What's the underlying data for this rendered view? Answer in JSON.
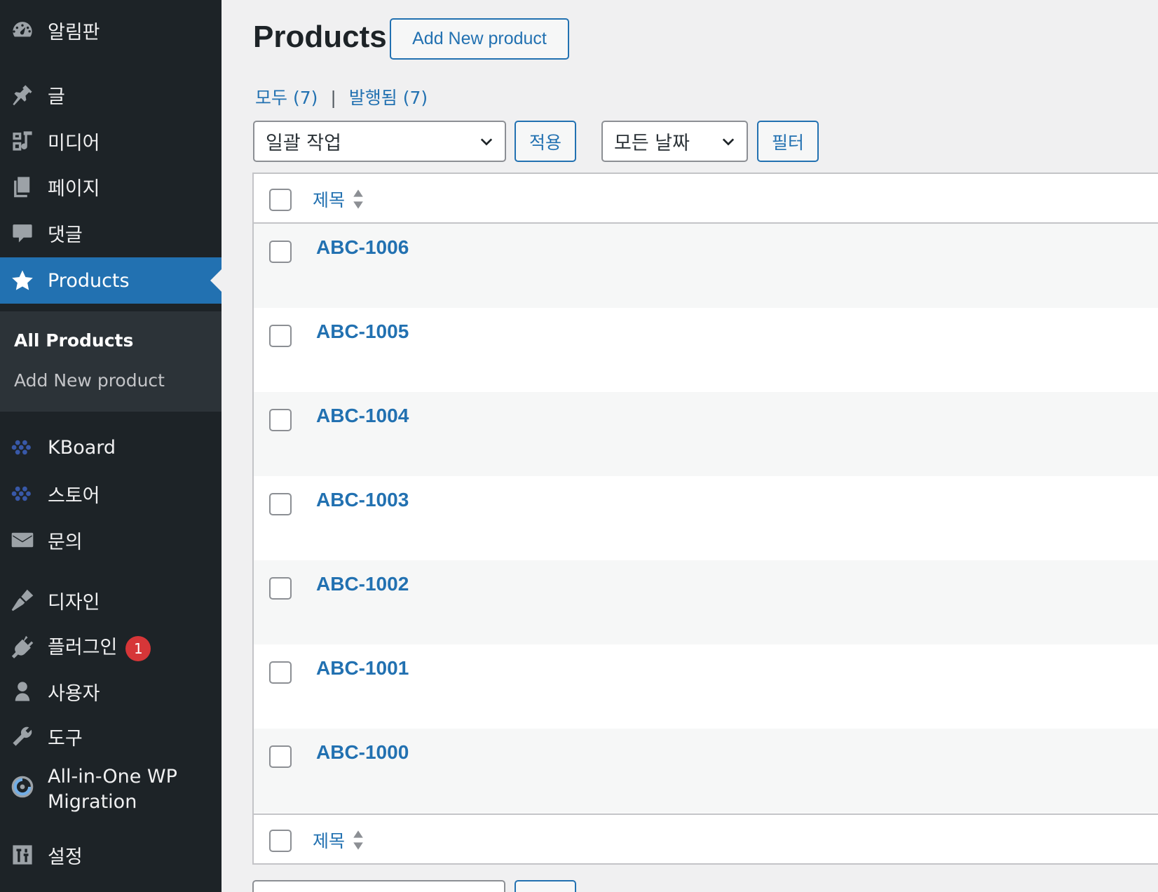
{
  "sidebar": {
    "items": [
      {
        "label": "알림판",
        "icon": "dashboard-icon"
      },
      {
        "label": "글",
        "icon": "pin-icon"
      },
      {
        "label": "미디어",
        "icon": "media-icon"
      },
      {
        "label": "페이지",
        "icon": "page-icon"
      },
      {
        "label": "댓글",
        "icon": "comment-icon"
      },
      {
        "label": "Products",
        "icon": "star-icon",
        "active": true
      },
      {
        "label": "KBoard",
        "icon": "kboard-icon"
      },
      {
        "label": "스토어",
        "icon": "store-icon"
      },
      {
        "label": "문의",
        "icon": "mail-icon"
      },
      {
        "label": "디자인",
        "icon": "brush-icon"
      },
      {
        "label": "플러그인",
        "icon": "plugin-icon",
        "badge": "1"
      },
      {
        "label": "사용자",
        "icon": "user-icon"
      },
      {
        "label": "도구",
        "icon": "wrench-icon"
      },
      {
        "label": "All-in-One WP",
        "label2": "Migration",
        "icon": "migration-icon"
      },
      {
        "label": "설정",
        "icon": "settings-icon"
      }
    ],
    "submenu": {
      "current": "All Products",
      "add_new": "Add New product"
    }
  },
  "main": {
    "title": "Products",
    "add_new_label": "Add New product",
    "views": {
      "all_label": "모두",
      "all_count": "(7)",
      "separator": "|",
      "published_label": "발행됨",
      "published_count": "(7)"
    },
    "bulk_action": {
      "selected": "일괄 작업",
      "apply_label": "적용"
    },
    "date_filter": {
      "selected": "모든 날짜",
      "filter_label": "필터"
    },
    "table": {
      "column_title": "제목",
      "rows": [
        "ABC-1006",
        "ABC-1005",
        "ABC-1004",
        "ABC-1003",
        "ABC-1002",
        "ABC-1001",
        "ABC-1000"
      ]
    }
  },
  "colors": {
    "sidebar_bg": "#1d2327",
    "accent": "#2271b1",
    "badge": "#d63638"
  }
}
